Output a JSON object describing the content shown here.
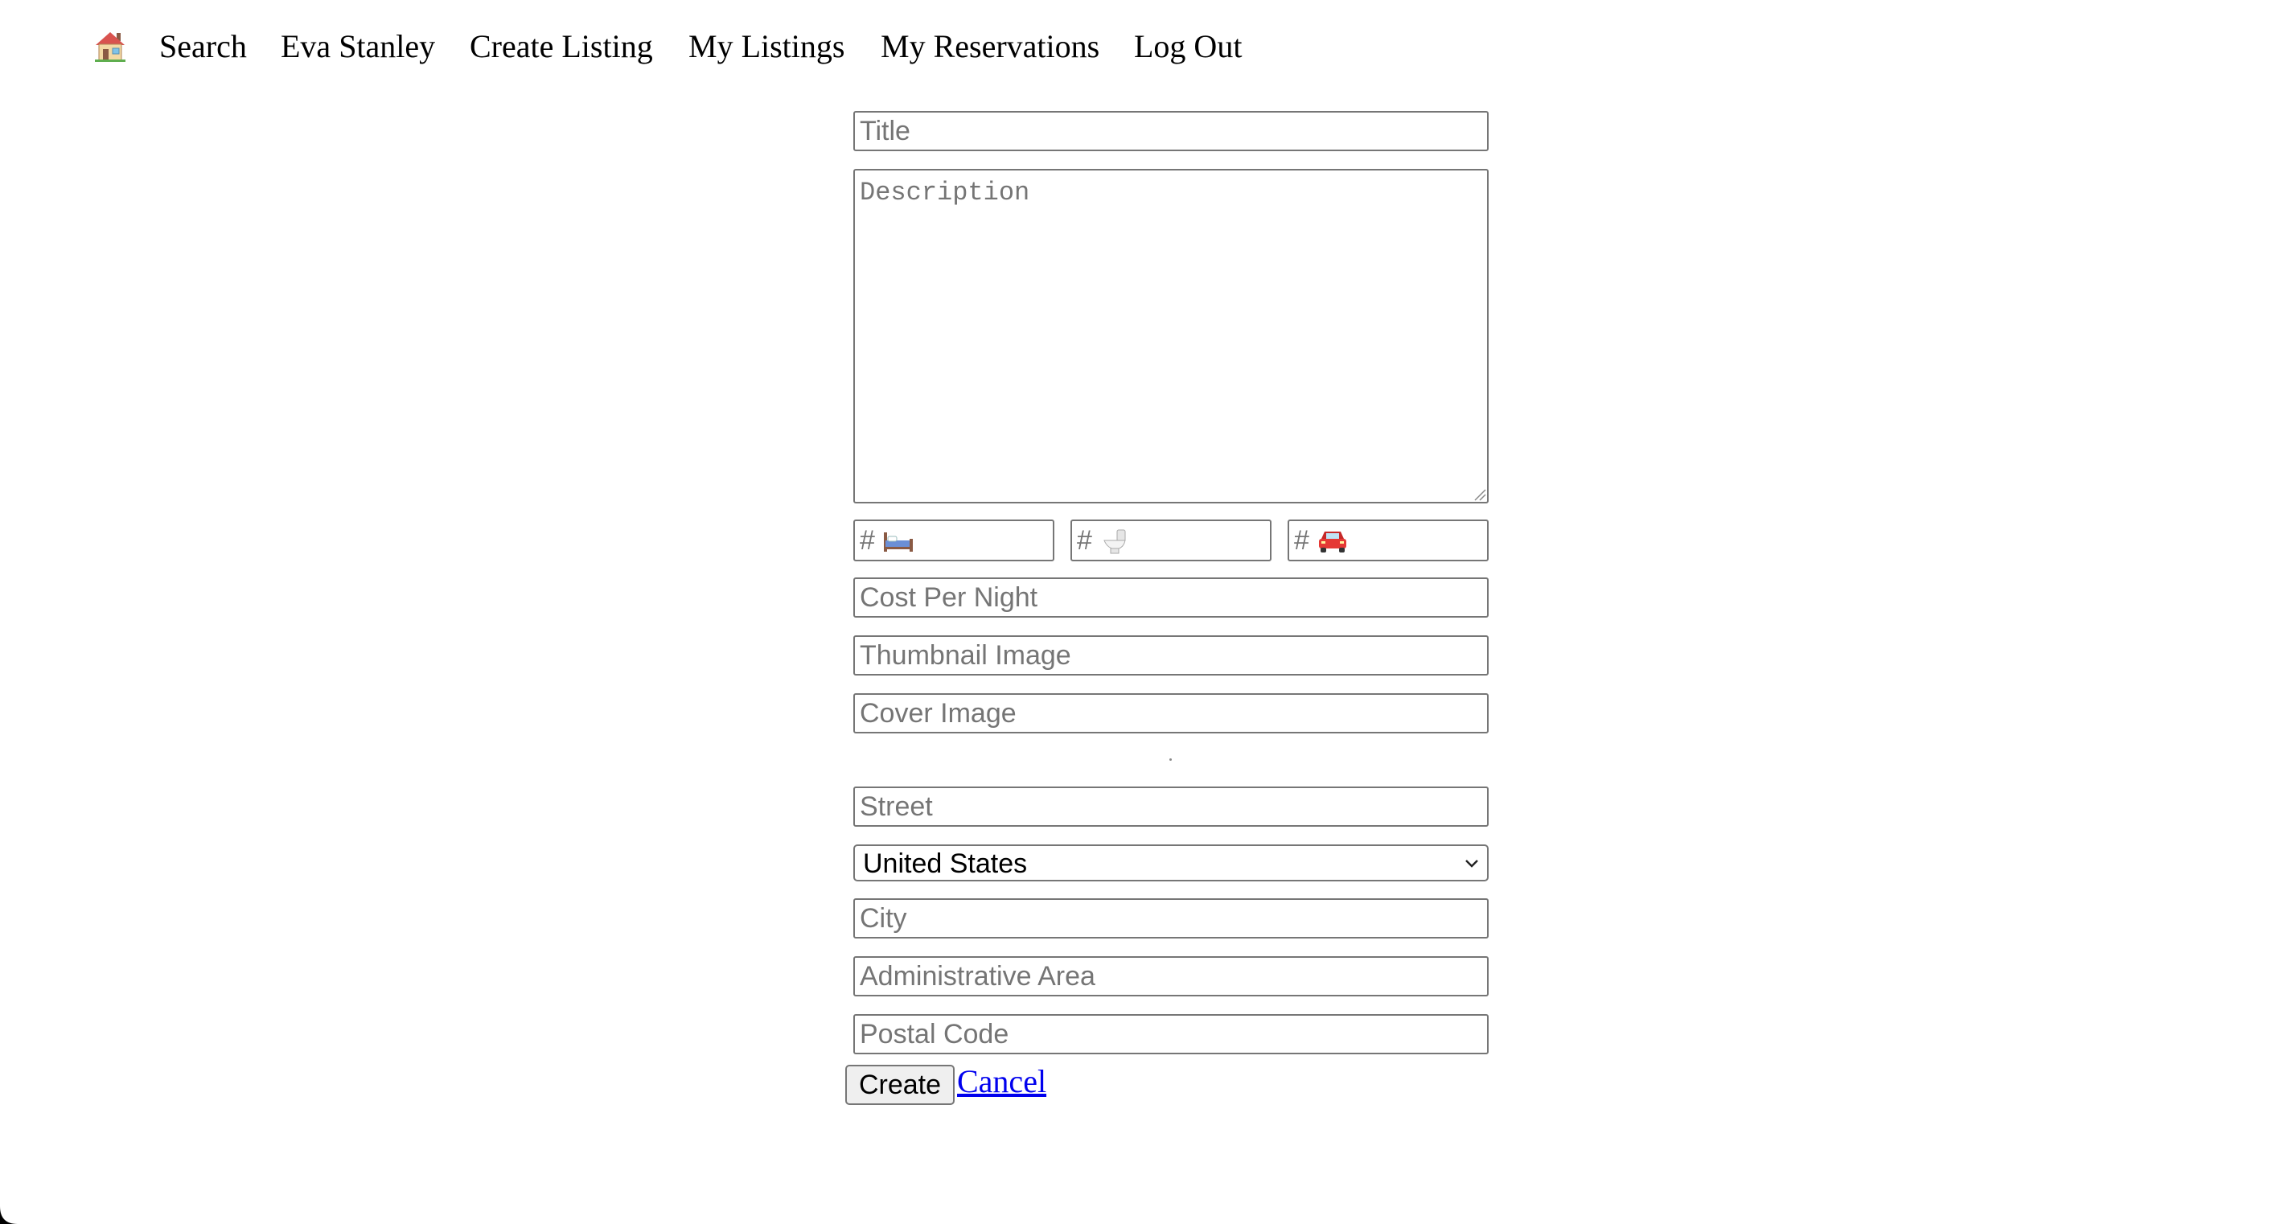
{
  "nav": {
    "home_icon": "house-emoji-icon",
    "links": {
      "search": "Search",
      "user": "Eva Stanley",
      "create_listing": "Create Listing",
      "my_listings": "My Listings",
      "my_reservations": "My Reservations",
      "log_out": "Log Out"
    }
  },
  "form": {
    "title_placeholder": "Title",
    "description_placeholder": "Description",
    "bedrooms": {
      "prefix": "#",
      "icon": "bed-icon"
    },
    "bathrooms": {
      "prefix": "#",
      "icon": "toilet-icon"
    },
    "parking": {
      "prefix": "#",
      "icon": "car-icon"
    },
    "cost_placeholder": "Cost Per Night",
    "thumbnail_placeholder": "Thumbnail Image",
    "cover_placeholder": "Cover Image",
    "street_placeholder": "Street",
    "country_selected": "United States",
    "city_placeholder": "City",
    "admin_area_placeholder": "Administrative Area",
    "postal_placeholder": "Postal Code",
    "create_label": "Create",
    "cancel_label": "Cancel"
  },
  "colors": {
    "link": "#0000ee",
    "field_border": "#767676",
    "placeholder": "#757575",
    "button_bg": "#efefef"
  }
}
